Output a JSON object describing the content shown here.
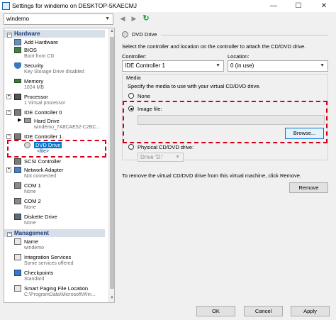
{
  "window": {
    "title": "Settings for windemo on DESKTOP-5KAECMJ"
  },
  "toolbar": {
    "vm_select": "windemo"
  },
  "hardware": {
    "section_label": "Hardware",
    "items": [
      {
        "label": "Add Hardware",
        "sub": ""
      },
      {
        "label": "BIOS",
        "sub": "Boot from CD"
      },
      {
        "label": "Security",
        "sub": "Key Storage Drive disabled"
      },
      {
        "label": "Memory",
        "sub": "1024 MB"
      },
      {
        "label": "Processor",
        "sub": "1 Virtual processor"
      },
      {
        "label": "IDE Controller 0",
        "sub": ""
      },
      {
        "label": "Hard Drive",
        "sub": "windemo_7A8CAE52-C2BC..."
      },
      {
        "label": "IDE Controller 1",
        "sub": ""
      },
      {
        "label": "DVD Drive",
        "sub": "<file>"
      },
      {
        "label": "SCSI Controller",
        "sub": ""
      },
      {
        "label": "Network Adapter",
        "sub": "Not connected"
      },
      {
        "label": "COM 1",
        "sub": "None"
      },
      {
        "label": "COM 2",
        "sub": "None"
      },
      {
        "label": "Diskette Drive",
        "sub": "None"
      }
    ]
  },
  "management": {
    "section_label": "Management",
    "items": [
      {
        "label": "Name",
        "sub": "windemo"
      },
      {
        "label": "Integration Services",
        "sub": "Some services offered"
      },
      {
        "label": "Checkpoints",
        "sub": "Standard"
      },
      {
        "label": "Smart Paging File Location",
        "sub": "C:\\ProgramData\\Microsoft\\Win..."
      }
    ]
  },
  "dvd": {
    "header": "DVD Drive",
    "intro": "Select the controller and location on the controller to attach the CD/DVD drive.",
    "controller_label": "Controller:",
    "controller_value": "IDE Controller 1",
    "location_label": "Location:",
    "location_value": "0 (in use)",
    "media_label": "Media",
    "media_intro": "Specify the media to use with your virtual CD/DVD drive.",
    "none_label": "None",
    "image_file_label": "Image file:",
    "image_file_value": "",
    "browse_label": "Browse...",
    "physical_label": "Physical CD/DVD drive:",
    "physical_value": "Drive 'D:'",
    "remove_text": "To remove the virtual CD/DVD drive from this virtual machine, click Remove.",
    "remove_label": "Remove",
    "selected_media": "image_file"
  },
  "footer": {
    "ok": "OK",
    "cancel": "Cancel",
    "apply": "Apply"
  },
  "colors": {
    "highlight_dash": "#d4001a",
    "section_bg": "#d7dfe9",
    "selection_bg": "#cce8ff"
  }
}
